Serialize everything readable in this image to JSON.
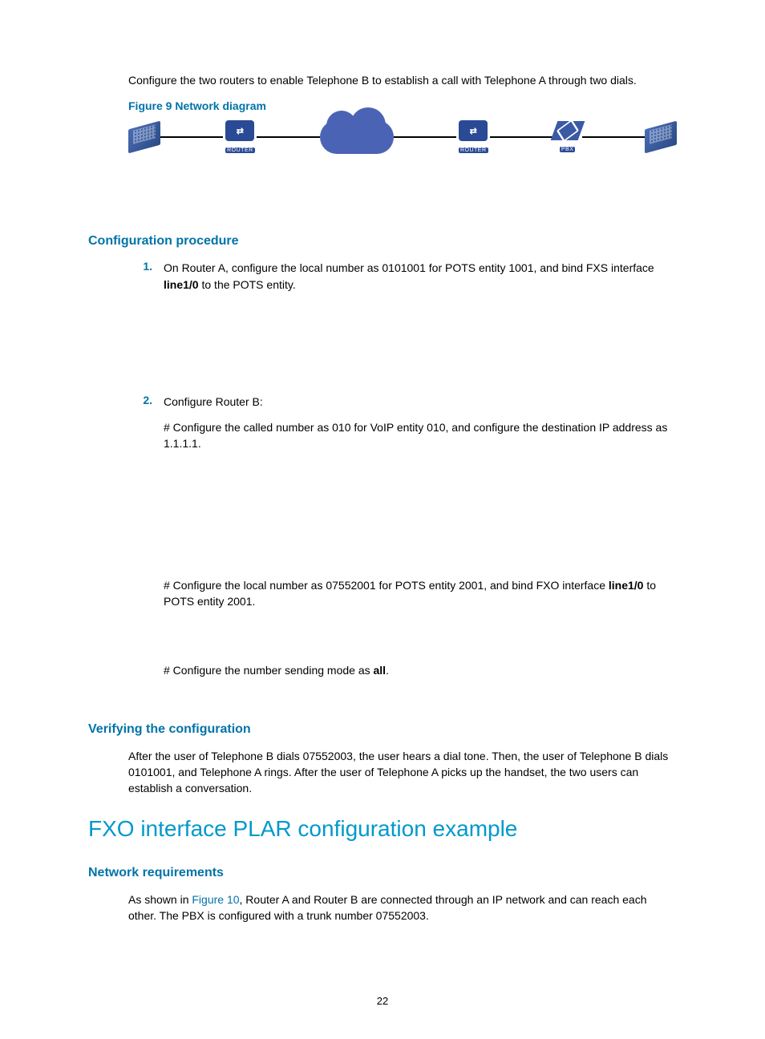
{
  "intro": "Configure the two routers to enable Telephone B to establish a call with Telephone A through two dials.",
  "figure_caption": "Figure 9 Network diagram",
  "diagram": {
    "router_label": "ROUTER",
    "pbx_label": "PBX",
    "router_glyph": "⇄"
  },
  "sec_config": {
    "heading": "Configuration procedure",
    "items": [
      {
        "num": "1.",
        "text_pre": "On Router A, configure the local number as 0101001 for POTS entity 1001, and bind FXS interface ",
        "bold1": "line1/0",
        "text_post": " to the POTS entity."
      },
      {
        "num": "2.",
        "text": "Configure Router B:"
      }
    ],
    "sub1": "# Configure the called number as 010 for VoIP entity 010, and configure the destination IP address as 1.1.1.1.",
    "sub2_pre": "# Configure the local number as 07552001 for POTS entity 2001, and bind FXO interface ",
    "sub2_bold": "line1/0",
    "sub2_post": " to POTS entity 2001.",
    "sub3_pre": "# Configure the number sending mode as ",
    "sub3_bold": "all",
    "sub3_post": "."
  },
  "sec_verify": {
    "heading": "Verifying the configuration",
    "text": "After the user of Telephone B dials 07552003, the user hears a dial tone. Then, the user of Telephone B dials 0101001, and Telephone A rings. After the user of Telephone A picks up the handset, the two users can establish a conversation."
  },
  "h1": "FXO interface PLAR configuration example",
  "sec_netreq": {
    "heading": "Network requirements",
    "pre": "As shown in ",
    "link": "Figure 10",
    "post": ", Router A and Router B are connected through an IP network and can reach each other. The PBX is configured with a trunk number 07552003."
  },
  "page_number": "22"
}
